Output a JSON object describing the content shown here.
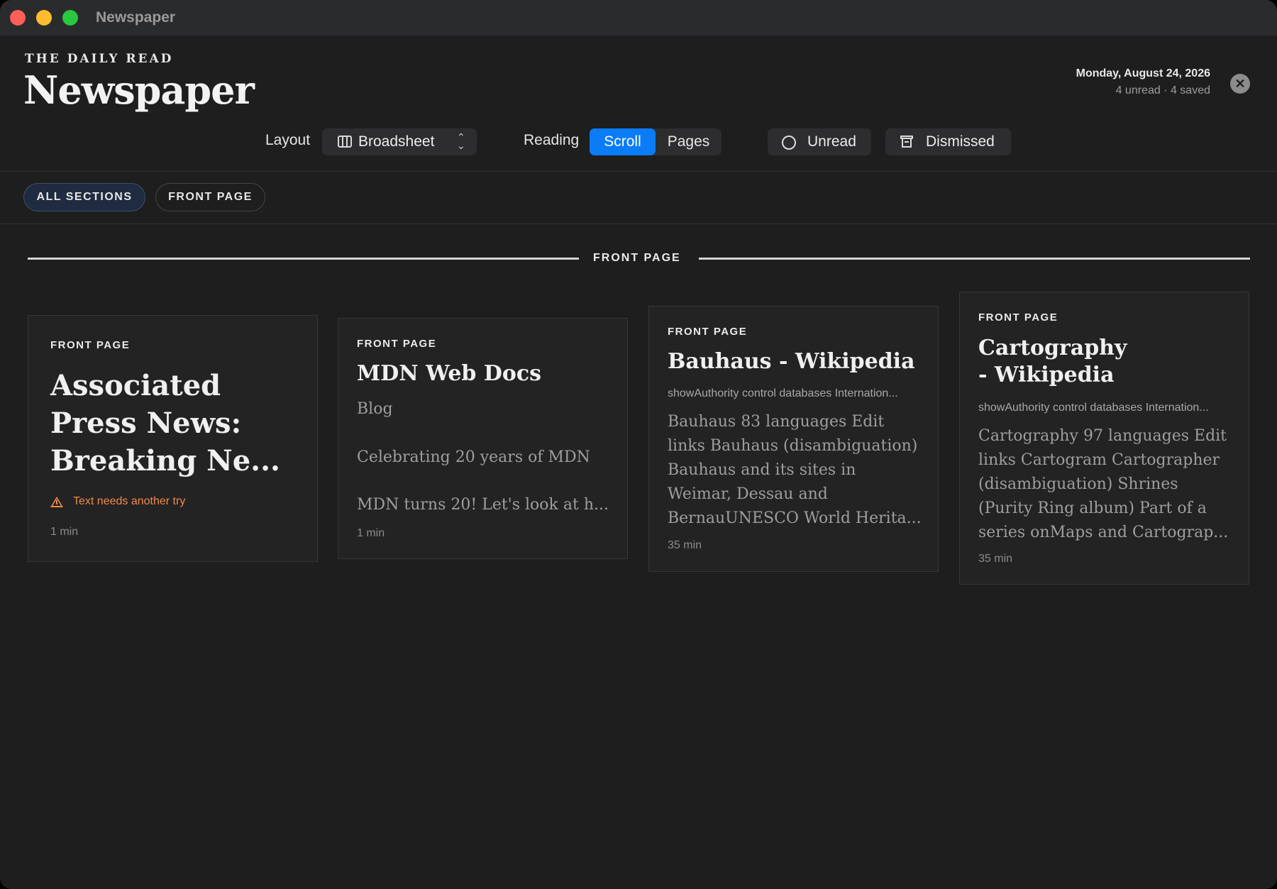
{
  "window": {
    "title": "Newspaper"
  },
  "masthead": {
    "kicker": "THE DAILY READ",
    "title": "Newspaper"
  },
  "status": {
    "date": "Monday, August 24, 2026",
    "counts": "4 unread · 4 saved"
  },
  "toolbar": {
    "layout_label": "Layout",
    "layout_value": "Broadsheet",
    "reading_label": "Reading",
    "reading_options": [
      "Scroll",
      "Pages"
    ],
    "reading_selected": "Scroll",
    "unread_label": "Unread",
    "dismissed_label": "Dismissed"
  },
  "filters": {
    "chips": [
      "ALL SECTIONS",
      "FRONT PAGE"
    ],
    "active": "ALL SECTIONS"
  },
  "section": {
    "title": "FRONT PAGE"
  },
  "articles": [
    {
      "kicker": "FRONT PAGE",
      "headline": "Associated Press News: Breaking Ne...",
      "warning": "Text needs another try",
      "read_time": "1 min"
    },
    {
      "kicker": "FRONT PAGE",
      "headline": "MDN Web Docs",
      "subhead": "Blog",
      "line1": "Celebrating 20 years of MDN",
      "line2": "MDN turns 20! Let's look at h...",
      "read_time": "1 min"
    },
    {
      "kicker": "FRONT PAGE",
      "headline": "Bauhaus - Wikipedia",
      "tag_line": "showAuthority control databases Internation...",
      "excerpt": "Bauhaus 83 languages Edit links Bauhaus (disambiguation) Bauhaus and its sites in Weimar, Dessau and BernauUNESCO World Herita...",
      "read_time": "35 min"
    },
    {
      "kicker": "FRONT PAGE",
      "headline_line1": "Cartography",
      "headline_line2": "- Wikipedia",
      "tag_line": "showAuthority control databases Internation...",
      "excerpt": "Cartography 97 languages Edit links Cartogram Cartographer (disambiguation) Shrines (Purity Ring album) Part of a series onMaps and Cartograp...",
      "read_time": "35 min"
    }
  ],
  "colors": {
    "accent": "#0a7cf7",
    "warning": "#f0894a",
    "background": "#1e1e1e"
  },
  "icons": {
    "layout": "columns-icon",
    "select": "chevron-up-down-icon",
    "unread": "circle-icon",
    "dismissed": "archive-box-icon",
    "close": "close-icon",
    "warning": "warning-triangle-icon"
  }
}
